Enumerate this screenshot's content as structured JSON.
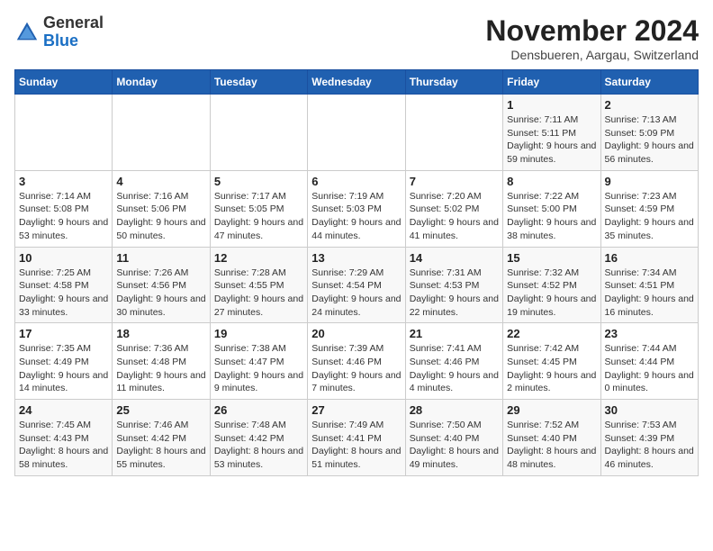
{
  "header": {
    "logo_line1": "General",
    "logo_line2": "Blue",
    "month_title": "November 2024",
    "location": "Densbueren, Aargau, Switzerland"
  },
  "calendar": {
    "days_of_week": [
      "Sunday",
      "Monday",
      "Tuesday",
      "Wednesday",
      "Thursday",
      "Friday",
      "Saturday"
    ],
    "weeks": [
      [
        {
          "day": "",
          "info": ""
        },
        {
          "day": "",
          "info": ""
        },
        {
          "day": "",
          "info": ""
        },
        {
          "day": "",
          "info": ""
        },
        {
          "day": "",
          "info": ""
        },
        {
          "day": "1",
          "info": "Sunrise: 7:11 AM\nSunset: 5:11 PM\nDaylight: 9 hours and 59 minutes."
        },
        {
          "day": "2",
          "info": "Sunrise: 7:13 AM\nSunset: 5:09 PM\nDaylight: 9 hours and 56 minutes."
        }
      ],
      [
        {
          "day": "3",
          "info": "Sunrise: 7:14 AM\nSunset: 5:08 PM\nDaylight: 9 hours and 53 minutes."
        },
        {
          "day": "4",
          "info": "Sunrise: 7:16 AM\nSunset: 5:06 PM\nDaylight: 9 hours and 50 minutes."
        },
        {
          "day": "5",
          "info": "Sunrise: 7:17 AM\nSunset: 5:05 PM\nDaylight: 9 hours and 47 minutes."
        },
        {
          "day": "6",
          "info": "Sunrise: 7:19 AM\nSunset: 5:03 PM\nDaylight: 9 hours and 44 minutes."
        },
        {
          "day": "7",
          "info": "Sunrise: 7:20 AM\nSunset: 5:02 PM\nDaylight: 9 hours and 41 minutes."
        },
        {
          "day": "8",
          "info": "Sunrise: 7:22 AM\nSunset: 5:00 PM\nDaylight: 9 hours and 38 minutes."
        },
        {
          "day": "9",
          "info": "Sunrise: 7:23 AM\nSunset: 4:59 PM\nDaylight: 9 hours and 35 minutes."
        }
      ],
      [
        {
          "day": "10",
          "info": "Sunrise: 7:25 AM\nSunset: 4:58 PM\nDaylight: 9 hours and 33 minutes."
        },
        {
          "day": "11",
          "info": "Sunrise: 7:26 AM\nSunset: 4:56 PM\nDaylight: 9 hours and 30 minutes."
        },
        {
          "day": "12",
          "info": "Sunrise: 7:28 AM\nSunset: 4:55 PM\nDaylight: 9 hours and 27 minutes."
        },
        {
          "day": "13",
          "info": "Sunrise: 7:29 AM\nSunset: 4:54 PM\nDaylight: 9 hours and 24 minutes."
        },
        {
          "day": "14",
          "info": "Sunrise: 7:31 AM\nSunset: 4:53 PM\nDaylight: 9 hours and 22 minutes."
        },
        {
          "day": "15",
          "info": "Sunrise: 7:32 AM\nSunset: 4:52 PM\nDaylight: 9 hours and 19 minutes."
        },
        {
          "day": "16",
          "info": "Sunrise: 7:34 AM\nSunset: 4:51 PM\nDaylight: 9 hours and 16 minutes."
        }
      ],
      [
        {
          "day": "17",
          "info": "Sunrise: 7:35 AM\nSunset: 4:49 PM\nDaylight: 9 hours and 14 minutes."
        },
        {
          "day": "18",
          "info": "Sunrise: 7:36 AM\nSunset: 4:48 PM\nDaylight: 9 hours and 11 minutes."
        },
        {
          "day": "19",
          "info": "Sunrise: 7:38 AM\nSunset: 4:47 PM\nDaylight: 9 hours and 9 minutes."
        },
        {
          "day": "20",
          "info": "Sunrise: 7:39 AM\nSunset: 4:46 PM\nDaylight: 9 hours and 7 minutes."
        },
        {
          "day": "21",
          "info": "Sunrise: 7:41 AM\nSunset: 4:46 PM\nDaylight: 9 hours and 4 minutes."
        },
        {
          "day": "22",
          "info": "Sunrise: 7:42 AM\nSunset: 4:45 PM\nDaylight: 9 hours and 2 minutes."
        },
        {
          "day": "23",
          "info": "Sunrise: 7:44 AM\nSunset: 4:44 PM\nDaylight: 9 hours and 0 minutes."
        }
      ],
      [
        {
          "day": "24",
          "info": "Sunrise: 7:45 AM\nSunset: 4:43 PM\nDaylight: 8 hours and 58 minutes."
        },
        {
          "day": "25",
          "info": "Sunrise: 7:46 AM\nSunset: 4:42 PM\nDaylight: 8 hours and 55 minutes."
        },
        {
          "day": "26",
          "info": "Sunrise: 7:48 AM\nSunset: 4:42 PM\nDaylight: 8 hours and 53 minutes."
        },
        {
          "day": "27",
          "info": "Sunrise: 7:49 AM\nSunset: 4:41 PM\nDaylight: 8 hours and 51 minutes."
        },
        {
          "day": "28",
          "info": "Sunrise: 7:50 AM\nSunset: 4:40 PM\nDaylight: 8 hours and 49 minutes."
        },
        {
          "day": "29",
          "info": "Sunrise: 7:52 AM\nSunset: 4:40 PM\nDaylight: 8 hours and 48 minutes."
        },
        {
          "day": "30",
          "info": "Sunrise: 7:53 AM\nSunset: 4:39 PM\nDaylight: 8 hours and 46 minutes."
        }
      ]
    ]
  }
}
